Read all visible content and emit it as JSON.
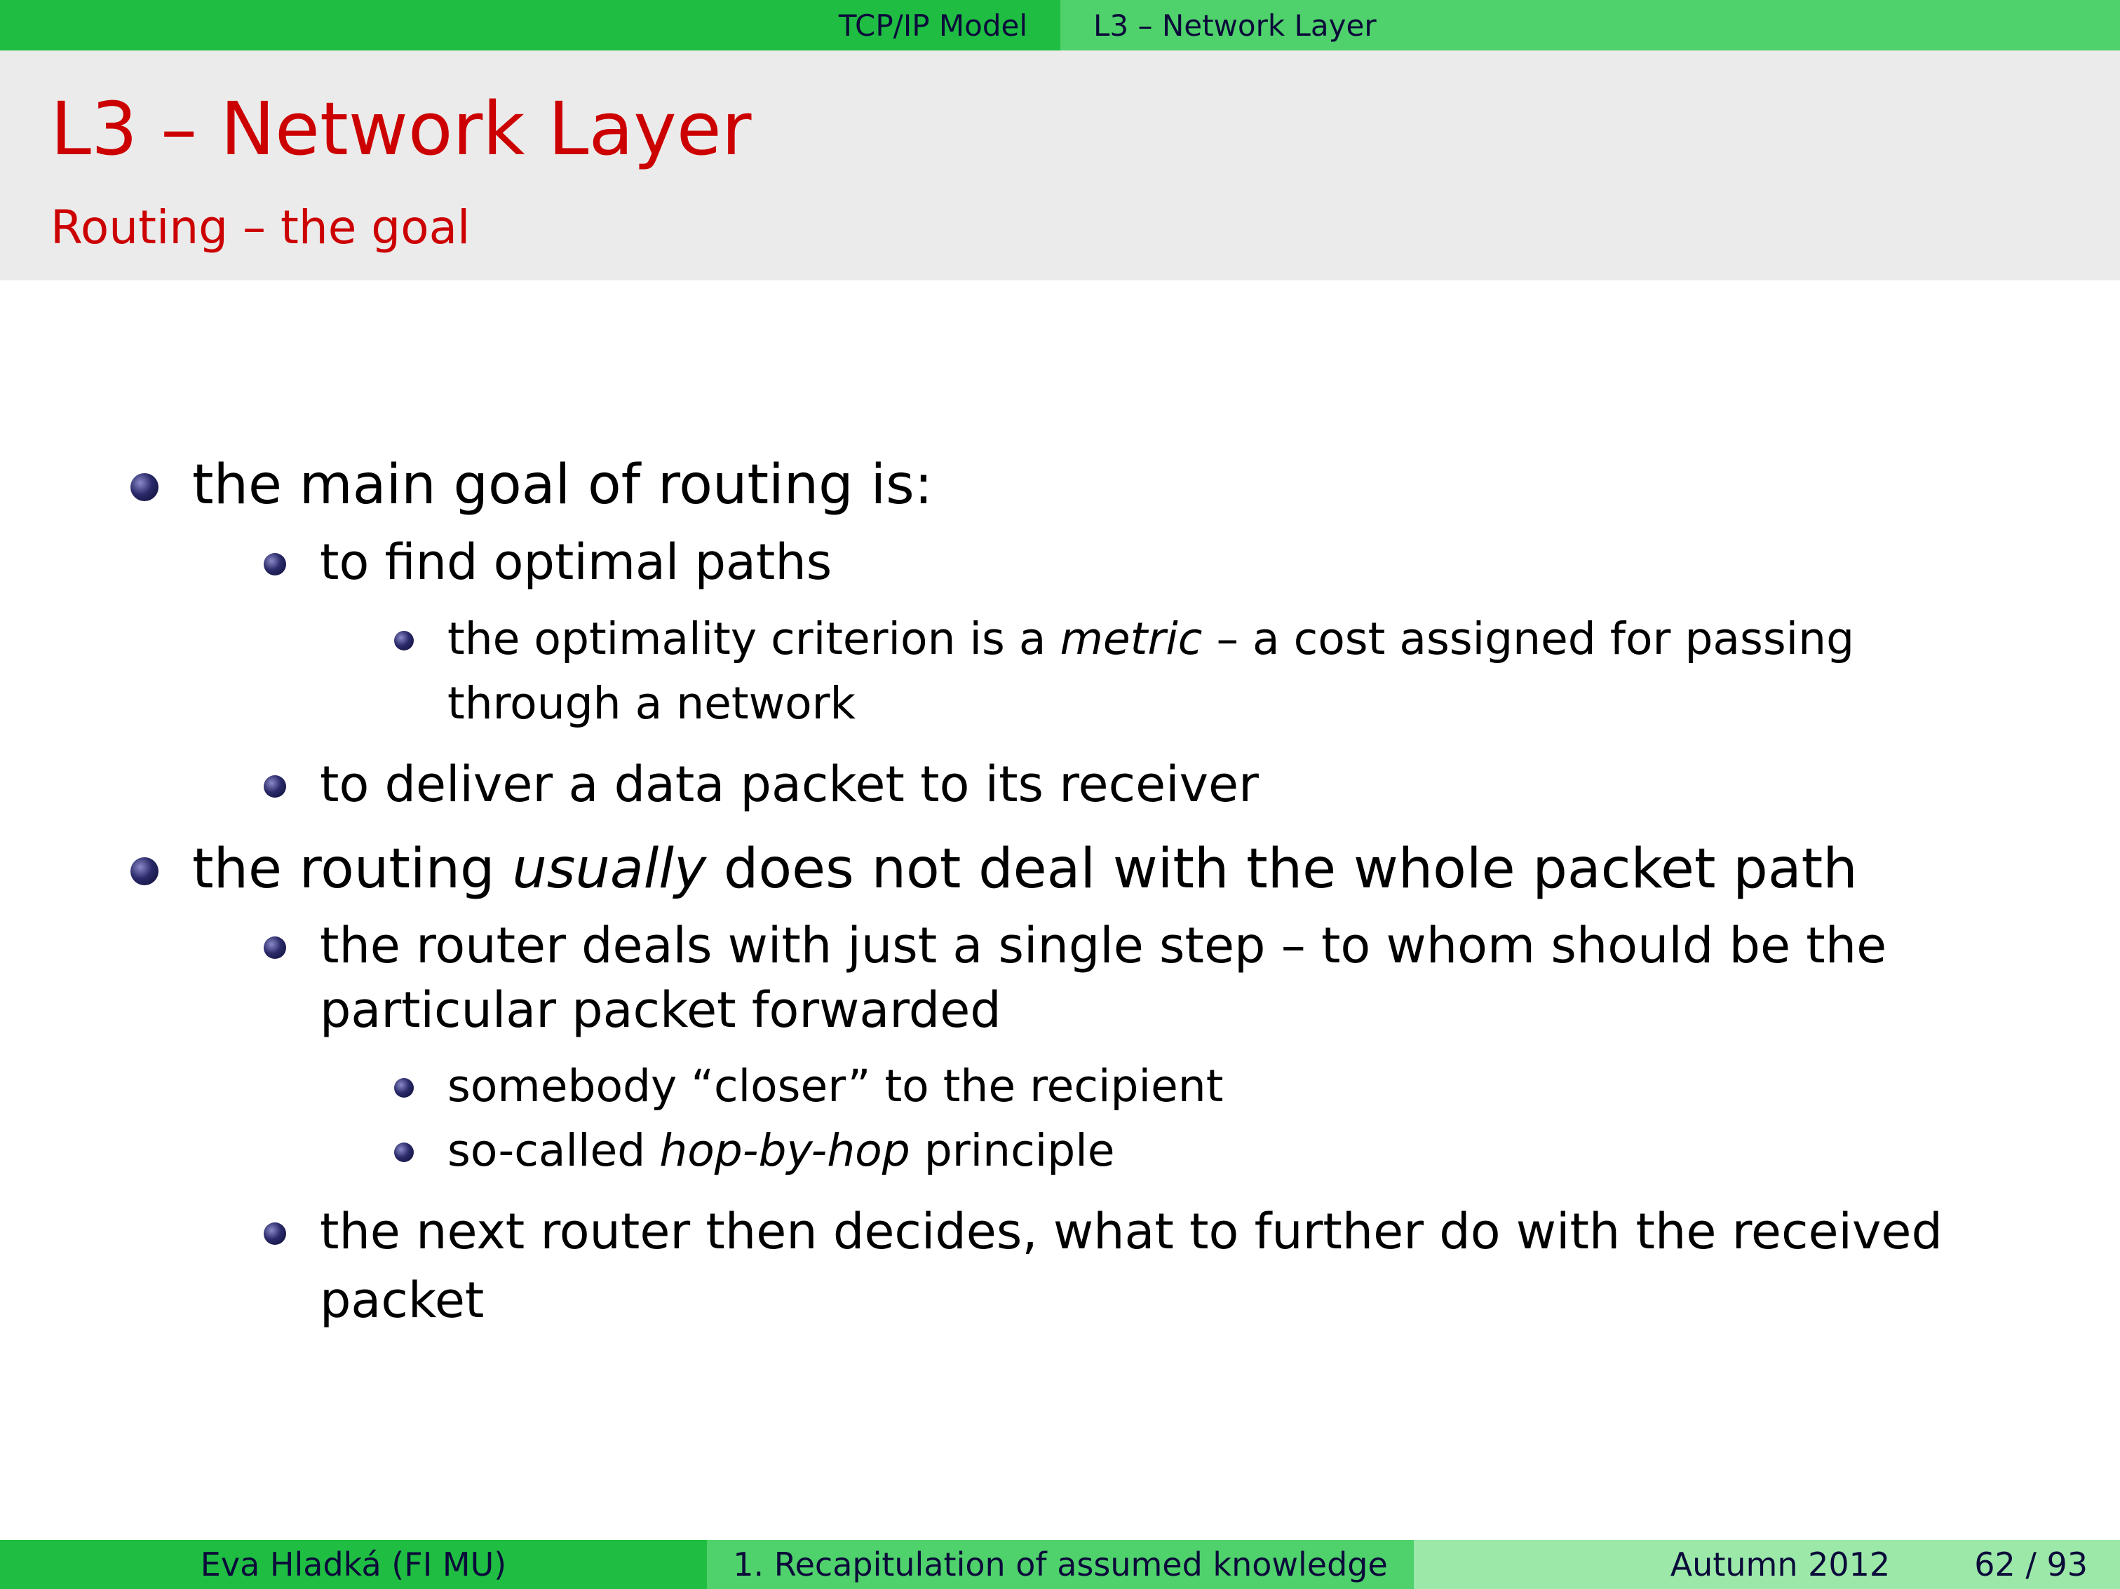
{
  "header": {
    "section": "TCP/IP Model",
    "subsection": "L3 – Network Layer"
  },
  "frame": {
    "title": "L3 – Network Layer",
    "subtitle": "Routing – the goal"
  },
  "bullets": {
    "b1": "the main goal of routing is:",
    "b1_1": "to find optimal paths",
    "b1_1_1_pre": "the optimality criterion is a ",
    "b1_1_1_em": "metric",
    "b1_1_1_post": " – a cost assigned for passing",
    "b1_1_1_cont": "through a network",
    "b1_2": "to deliver a data packet to its receiver",
    "b2_pre": "the routing ",
    "b2_em": "usually",
    "b2_post": " does not deal with the whole packet path",
    "b2_1": "the router deals with just a single step – to whom should be the",
    "b2_1_cont": "particular packet forwarded",
    "b2_1_1": "somebody “closer” to the recipient",
    "b2_1_2_pre": "so-called ",
    "b2_1_2_em": "hop-by-hop",
    "b2_1_2_post": " principle",
    "b2_2": "the next router then decides, what to further do with the received",
    "b2_2_cont": "packet"
  },
  "footer": {
    "author": "Eva Hladká  (FI MU)",
    "talk": "1. Recapitulation of assumed knowledge",
    "date": "Autumn 2012",
    "page": "62 / 93"
  },
  "colors": {
    "header_dark_green": "#1fbe42",
    "header_light_green": "#4fd16b",
    "footer_pale_green": "#9be8a8",
    "title_red": "#cc0000",
    "title_band_gray": "#ebebeb",
    "bullet_navy": "#0b0b32"
  }
}
